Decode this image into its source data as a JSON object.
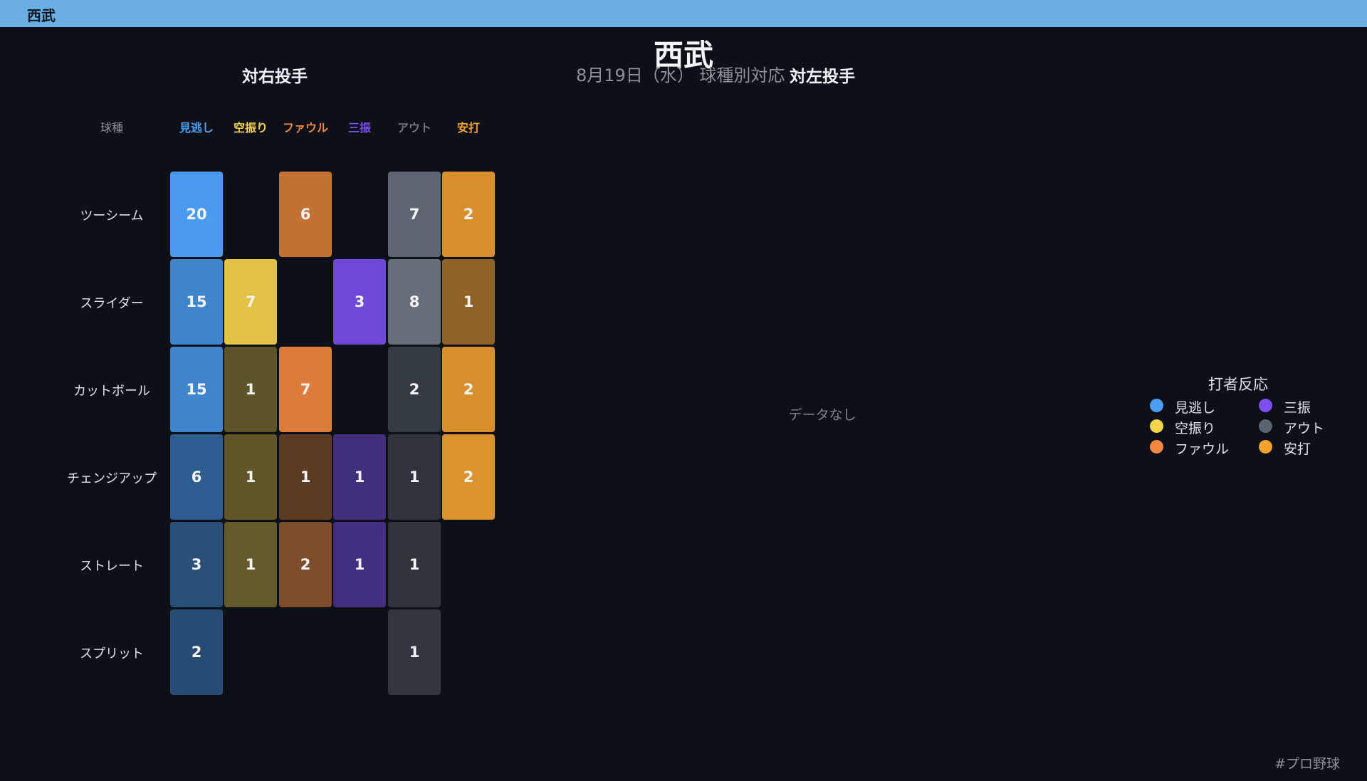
{
  "window": {
    "title": "西武"
  },
  "header": {
    "title": "西武",
    "subtitle": "8月19日（水） 球種別対応"
  },
  "panels": {
    "vs_right": {
      "title": "対右投手"
    },
    "vs_left": {
      "title": "対左投手",
      "empty_text": "データなし"
    }
  },
  "legend": {
    "title": "打者反応",
    "items": [
      {
        "label": "見逃し",
        "color": "#4a9ff5"
      },
      {
        "label": "三振",
        "color": "#7b4ff0"
      },
      {
        "label": "空振り",
        "color": "#f6d44a"
      },
      {
        "label": "アウト",
        "color": "#5a6470"
      },
      {
        "label": "ファウル",
        "color": "#f0883e"
      },
      {
        "label": "安打",
        "color": "#f4a130"
      }
    ]
  },
  "footer": {
    "hashtag": "#プロ野球"
  },
  "chart_data": {
    "type": "heatmap",
    "title": "対右投手",
    "row_header": "球種",
    "columns": [
      {
        "label": "見逃し",
        "color": "#4a9ff5"
      },
      {
        "label": "空振り",
        "color": "#f6d44a"
      },
      {
        "label": "ファウル",
        "color": "#f0883e"
      },
      {
        "label": "三振",
        "color": "#7b4ff0"
      },
      {
        "label": "アウト",
        "color": "#6e7781"
      },
      {
        "label": "安打",
        "color": "#f4a130"
      }
    ],
    "rows": [
      "ツーシーム",
      "スライダー",
      "カットボール",
      "チェンジアップ",
      "ストレート",
      "スプリット"
    ],
    "values": [
      [
        20,
        null,
        6,
        null,
        7,
        2
      ],
      [
        15,
        7,
        null,
        3,
        8,
        1
      ],
      [
        15,
        1,
        7,
        null,
        2,
        2
      ],
      [
        6,
        1,
        1,
        1,
        1,
        2
      ],
      [
        3,
        1,
        2,
        1,
        1,
        null
      ],
      [
        2,
        null,
        null,
        null,
        1,
        null
      ]
    ]
  }
}
